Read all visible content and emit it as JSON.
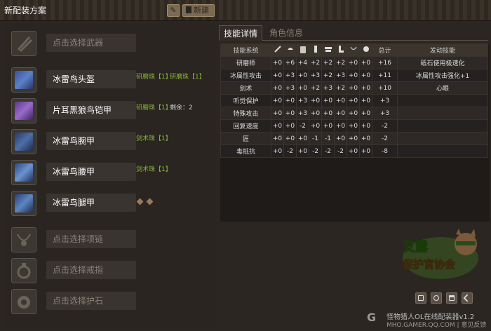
{
  "header": {
    "title": "新配装方案",
    "new_label": "新建"
  },
  "slots": [
    {
      "name": "点击选择武器",
      "empty": true
    },
    {
      "name": "冰雷鸟头盔",
      "decorations": [
        "研磨珠【1】",
        "研磨珠【1】"
      ]
    },
    {
      "name": "片耳黑狼鸟铠甲",
      "decorations": [
        "研磨珠【1】"
      ],
      "remaining": "剩余：2"
    },
    {
      "name": "冰雷鸟腕甲",
      "decorations": [
        "剑术珠【1】"
      ]
    },
    {
      "name": "冰雷鸟腰甲",
      "decorations": [
        "剑术珠【1】"
      ]
    },
    {
      "name": "冰雷鸟腿甲",
      "decorations": []
    },
    {
      "name": "点击选择项链",
      "empty": true
    },
    {
      "name": "点击选择戒指",
      "empty": true
    },
    {
      "name": "点击选择护石",
      "empty": true
    }
  ],
  "tabs": [
    {
      "label": "技能详情",
      "active": true
    },
    {
      "label": "角色信息",
      "active": false
    }
  ],
  "skills_table": {
    "col_skill": "技能系统",
    "col_total": "总计",
    "col_active": "发动技能",
    "rows": [
      {
        "name": "研磨师",
        "vals": [
          "+0",
          "+6",
          "+4",
          "+2",
          "+2",
          "+2",
          "+0",
          "+0"
        ],
        "total": "+16",
        "active": "砥石使用极速化"
      },
      {
        "name": "冰属性攻击",
        "vals": [
          "+0",
          "+3",
          "+0",
          "+3",
          "+2",
          "+3",
          "+0",
          "+0"
        ],
        "total": "+11",
        "active": "冰属性攻击强化+1"
      },
      {
        "name": "剑术",
        "vals": [
          "+0",
          "+3",
          "+0",
          "+2",
          "+3",
          "+2",
          "+0",
          "+0"
        ],
        "total": "+10",
        "active": "心眼"
      },
      {
        "name": "听觉保护",
        "vals": [
          "+0",
          "+0",
          "+3",
          "+0",
          "+0",
          "+0",
          "+0",
          "+0"
        ],
        "total": "+3",
        "active": ""
      },
      {
        "name": "特殊攻击",
        "vals": [
          "+0",
          "+0",
          "+3",
          "+0",
          "+0",
          "+0",
          "+0",
          "+0"
        ],
        "total": "+3",
        "active": ""
      },
      {
        "name": "回复速度",
        "vals": [
          "+0",
          "+0",
          "-2",
          "+0",
          "+0",
          "+0",
          "+0",
          "+0"
        ],
        "total": "-2",
        "active": ""
      },
      {
        "name": "匠",
        "vals": [
          "+0",
          "+0",
          "+0",
          "-1",
          "-1",
          "+0",
          "+0",
          "+0"
        ],
        "total": "-2",
        "active": ""
      },
      {
        "name": "毒抵抗",
        "vals": [
          "+0",
          "-2",
          "+0",
          "-2",
          "-2",
          "-2",
          "+0",
          "+0"
        ],
        "total": "-8",
        "active": ""
      }
    ]
  },
  "logo": {
    "text": "艾露保护官协会"
  },
  "brand": {
    "line1": "怪物猎人OL在线配装器v1.2",
    "line2": "MHO.GAMER.QQ.COM | 意见反馈"
  }
}
